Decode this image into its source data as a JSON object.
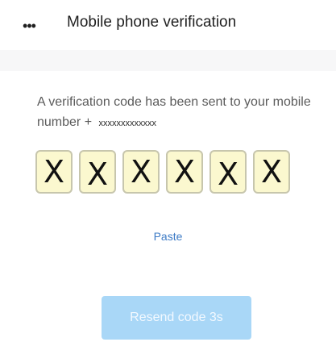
{
  "header": {
    "menu_icon": "•••",
    "title": "Mobile phone verification"
  },
  "verification": {
    "message": "A verification code has been sent to your mobile number",
    "country_code": "+",
    "phone_masked": "xxxxxxxxxxxxx",
    "code_digits": [
      "X",
      "X",
      "X",
      "X",
      "X",
      "X"
    ],
    "paste_label": "Paste",
    "resend_label": "Resend code 3s"
  },
  "colors": {
    "accent": "#3f7cc6",
    "resend_bg": "#a9d7f7",
    "code_box_bg": "#fbf8cf",
    "code_box_border": "#c7c6ad"
  }
}
